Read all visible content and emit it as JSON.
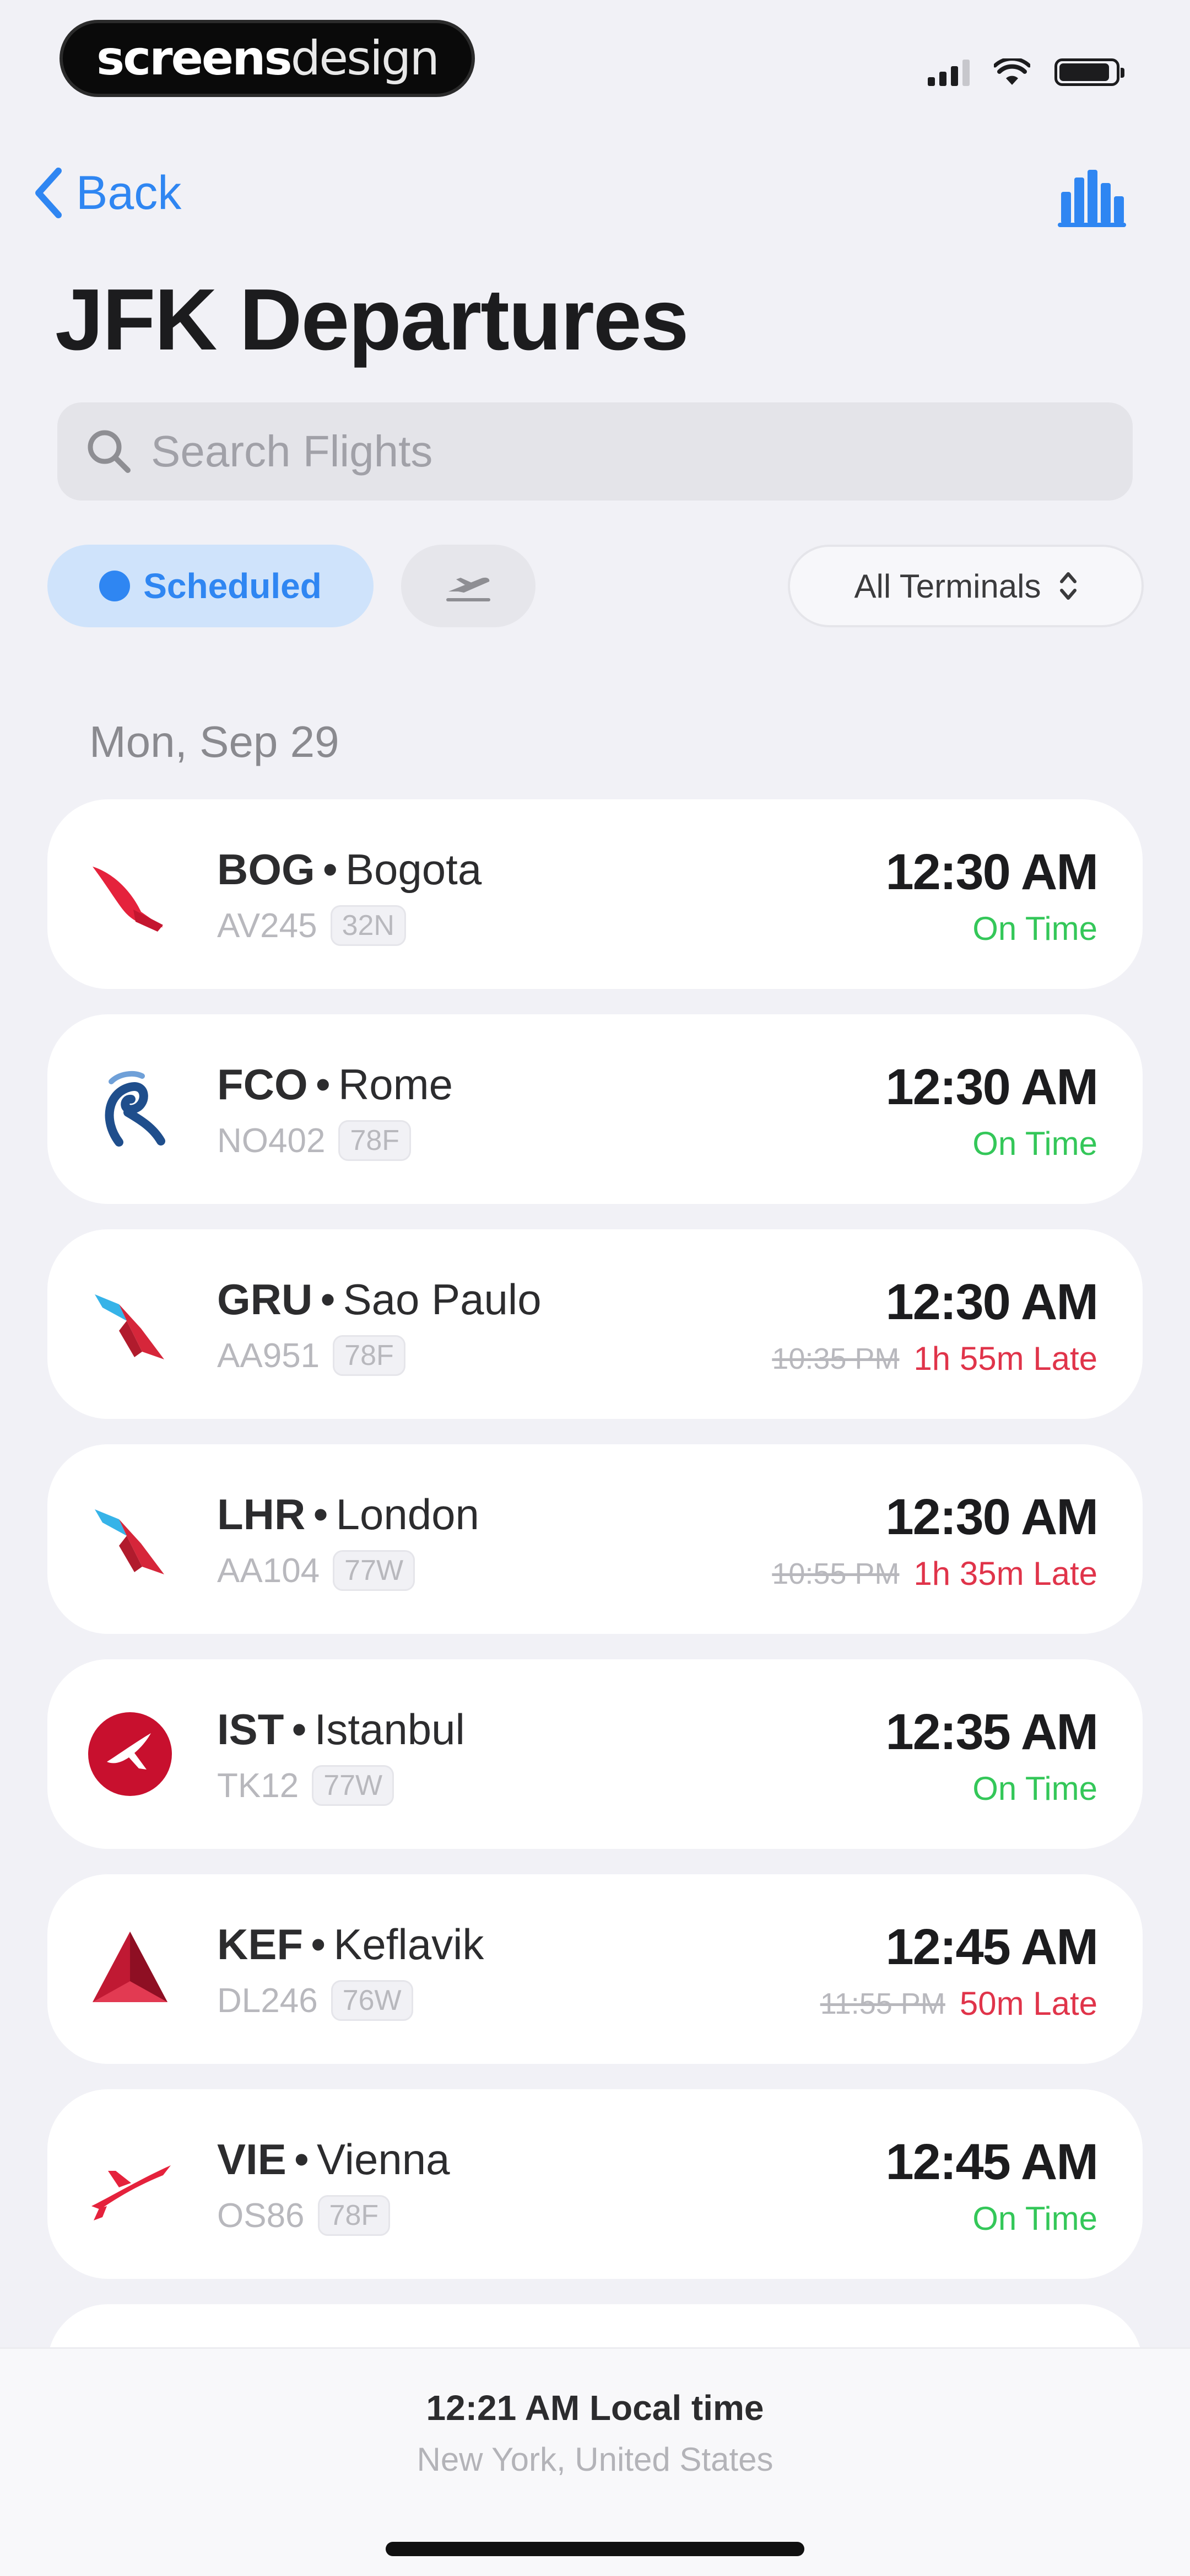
{
  "status_bar": {
    "brand_bold": "screens",
    "brand_light": "design"
  },
  "nav": {
    "back_label": "Back"
  },
  "page": {
    "title": "JFK Departures"
  },
  "search": {
    "placeholder": "Search Flights"
  },
  "filters": {
    "scheduled_label": "Scheduled",
    "terminal_label": "All Terminals"
  },
  "list": {
    "date_header": "Mon, Sep 29",
    "flights": [
      {
        "code": "BOG",
        "city": "Bogota",
        "flight": "AV245",
        "aircraft": "32N",
        "time": "12:30 AM",
        "original_time": "",
        "status": "On Time",
        "late": false,
        "airline_icon": "avianca-logo-icon"
      },
      {
        "code": "FCO",
        "city": "Rome",
        "flight": "NO402",
        "aircraft": "78F",
        "time": "12:30 AM",
        "original_time": "",
        "status": "On Time",
        "late": false,
        "airline_icon": "neos-logo-icon"
      },
      {
        "code": "GRU",
        "city": "Sao Paulo",
        "flight": "AA951",
        "aircraft": "78F",
        "time": "12:30 AM",
        "original_time": "10:35 PM",
        "status": "1h 55m Late",
        "late": true,
        "airline_icon": "american-airlines-logo-icon"
      },
      {
        "code": "LHR",
        "city": "London",
        "flight": "AA104",
        "aircraft": "77W",
        "time": "12:30 AM",
        "original_time": "10:55 PM",
        "status": "1h 35m Late",
        "late": true,
        "airline_icon": "american-airlines-logo-icon"
      },
      {
        "code": "IST",
        "city": "Istanbul",
        "flight": "TK12",
        "aircraft": "77W",
        "time": "12:35 AM",
        "original_time": "",
        "status": "On Time",
        "late": false,
        "airline_icon": "turkish-airlines-logo-icon"
      },
      {
        "code": "KEF",
        "city": "Keflavik",
        "flight": "DL246",
        "aircraft": "76W",
        "time": "12:45 AM",
        "original_time": "11:55 PM",
        "status": "50m Late",
        "late": true,
        "airline_icon": "delta-logo-icon"
      },
      {
        "code": "VIE",
        "city": "Vienna",
        "flight": "OS86",
        "aircraft": "78F",
        "time": "12:45 AM",
        "original_time": "",
        "status": "On Time",
        "late": false,
        "airline_icon": "austrian-logo-icon"
      }
    ]
  },
  "footer": {
    "local_time": "12:21 AM Local time",
    "location": "New York, United States"
  },
  "colors": {
    "accent": "#2f86f2",
    "on_time": "#34c759",
    "late": "#e0344a",
    "background": "#f1f1f6"
  }
}
